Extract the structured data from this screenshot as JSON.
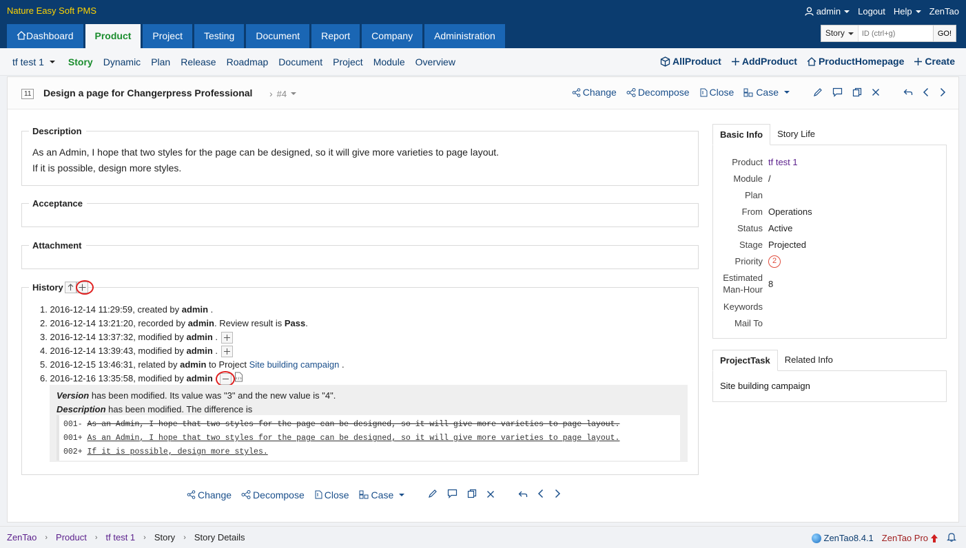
{
  "app": {
    "title": "Nature Easy Soft PMS"
  },
  "user_links": {
    "user": "admin",
    "logout": "Logout",
    "help": "Help",
    "brand": "ZenTao"
  },
  "main_nav": [
    {
      "label": "Dashboard"
    },
    {
      "label": "Product"
    },
    {
      "label": "Project"
    },
    {
      "label": "Testing"
    },
    {
      "label": "Document"
    },
    {
      "label": "Report"
    },
    {
      "label": "Company"
    },
    {
      "label": "Administration"
    }
  ],
  "search": {
    "type": "Story",
    "placeholder": "ID (ctrl+g)",
    "go": "GO!"
  },
  "sub_nav": {
    "product": "tf test 1",
    "items": [
      "Story",
      "Dynamic",
      "Plan",
      "Release",
      "Roadmap",
      "Document",
      "Project",
      "Module",
      "Overview"
    ],
    "right": [
      "AllProduct",
      "AddProduct",
      "ProductHomepage",
      "Create"
    ]
  },
  "story": {
    "id": "11",
    "title": "Design a page for Changerpress Professional",
    "version": "#4"
  },
  "actions": {
    "change": "Change",
    "decompose": "Decompose",
    "close": "Close",
    "case": "Case"
  },
  "sections": {
    "description": {
      "label": "Description",
      "lines": [
        "As an Admin, I hope that two styles for the page can be designed, so it will give more varieties to page layout.",
        "If it is possible, design more styles."
      ]
    },
    "acceptance": {
      "label": "Acceptance"
    },
    "attachment": {
      "label": "Attachment"
    },
    "history": {
      "label": "History",
      "entries": [
        {
          "n": "1.",
          "date": "2016-12-14 11:29:59",
          "pre": ", created by ",
          "user": "admin",
          "post": " ."
        },
        {
          "n": "2.",
          "date": "2016-12-14 13:21:20",
          "pre": ", recorded by ",
          "user": "admin",
          "post": ". Review result is ",
          "extra": "Pass",
          "post2": "."
        },
        {
          "n": "3.",
          "date": "2016-12-14 13:37:32",
          "pre": ", modified by ",
          "user": "admin",
          "post": " ."
        },
        {
          "n": "4.",
          "date": "2016-12-14 13:39:43",
          "pre": ", modified by ",
          "user": "admin",
          "post": " ."
        },
        {
          "n": "5.",
          "date": "2016-12-15 13:46:31",
          "pre": ", related by ",
          "user": "admin",
          "post": " to Project ",
          "link": "Site building campaign",
          "post2": " ."
        },
        {
          "n": "6.",
          "date": "2016-12-16 13:35:58",
          "pre": ", modified by ",
          "user": "admin",
          "post": ""
        }
      ],
      "diff": {
        "version_field": "Version",
        "version_text": " has been modified. Its value was \"3\" and the new value is \"4\".",
        "desc_field": "Description",
        "desc_text": " has been modified. The difference is",
        "lines": [
          {
            "prefix": "001- ",
            "text": "As an Admin, I hope that two styles for the page can be designed, so it will give more varieties to page layout.",
            "kind": "del"
          },
          {
            "prefix": "001+ ",
            "text": "As an Admin, I hope that two styles for the page can be designed, so it will give more varieties to page layout.",
            "kind": "ins"
          },
          {
            "prefix": "002+ ",
            "text": "If it is possible, design more styles.",
            "kind": "ins"
          }
        ]
      }
    }
  },
  "basic_info": {
    "tabs": [
      "Basic Info",
      "Story Life"
    ],
    "rows": [
      {
        "label": "Product",
        "value": "tf test 1"
      },
      {
        "label": "Module",
        "value": "/"
      },
      {
        "label": "Plan",
        "value": ""
      },
      {
        "label": "From",
        "value": "Operations"
      },
      {
        "label": "Status",
        "value": "Active"
      },
      {
        "label": "Stage",
        "value": "Projected"
      },
      {
        "label": "Priority",
        "value": "2"
      },
      {
        "label": "Estimated Man-Hour",
        "value": "8"
      },
      {
        "label": "Keywords",
        "value": ""
      },
      {
        "label": "Mail To",
        "value": ""
      }
    ],
    "estimated_line1": "Estimated",
    "estimated_line2": "Man-Hour"
  },
  "project_task": {
    "tabs": [
      "ProjectTask",
      "Related Info"
    ],
    "item": "Site building campaign"
  },
  "footer": {
    "crumbs": [
      "ZenTao",
      "Product",
      "tf test 1",
      "Story",
      "Story Details"
    ],
    "version": "ZenTao8.4.1",
    "pro": "ZenTao Pro"
  }
}
